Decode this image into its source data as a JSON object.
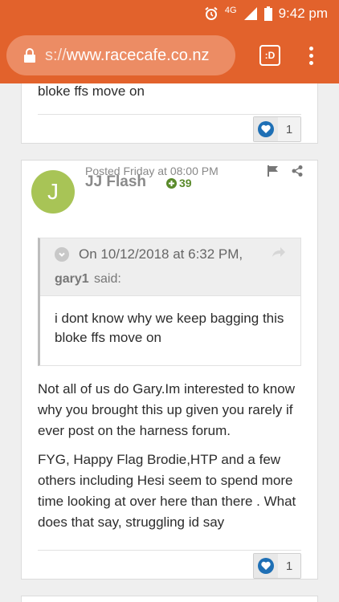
{
  "status_bar": {
    "network": "4G",
    "time": "9:42 pm"
  },
  "browser": {
    "url_protocol": "s://",
    "url_host": "www.racecafe.co.nz",
    "tab_label": ":D"
  },
  "post_prev": {
    "text_tail": "bloke ffs move on",
    "reputation": "1"
  },
  "post": {
    "avatar_letter": "J",
    "posted_text": "Posted Friday at 08:00 PM",
    "author": "JJ Flash",
    "author_reputation": "39",
    "quote": {
      "date_text": "On 10/12/2018 at 6:32 PM,",
      "user": "gary1",
      "said": "said:",
      "text": "i dont know why we keep bagging this bloke ffs move on"
    },
    "paragraphs": [
      "Not all of us do Gary.Im interested to know why you brought this up given you rarely if ever post on the harness forum.",
      "FYG, Happy Flag Brodie,HTP and a few others including Hesi seem to spend more time looking at over here than there . What does that say, struggling id say"
    ],
    "reputation": "1"
  },
  "icons": {
    "alarm": "alarm-icon",
    "signal": "signal-icon",
    "battery": "battery-icon",
    "lock": "lock-icon",
    "heart": "heart-icon",
    "flag": "flag-icon",
    "share": "share-icon"
  },
  "colors": {
    "chrome": "#e2622c",
    "avatar": "#a8c456",
    "reputation_positive": "#5a8a2b",
    "heart": "#1e6fb5"
  }
}
